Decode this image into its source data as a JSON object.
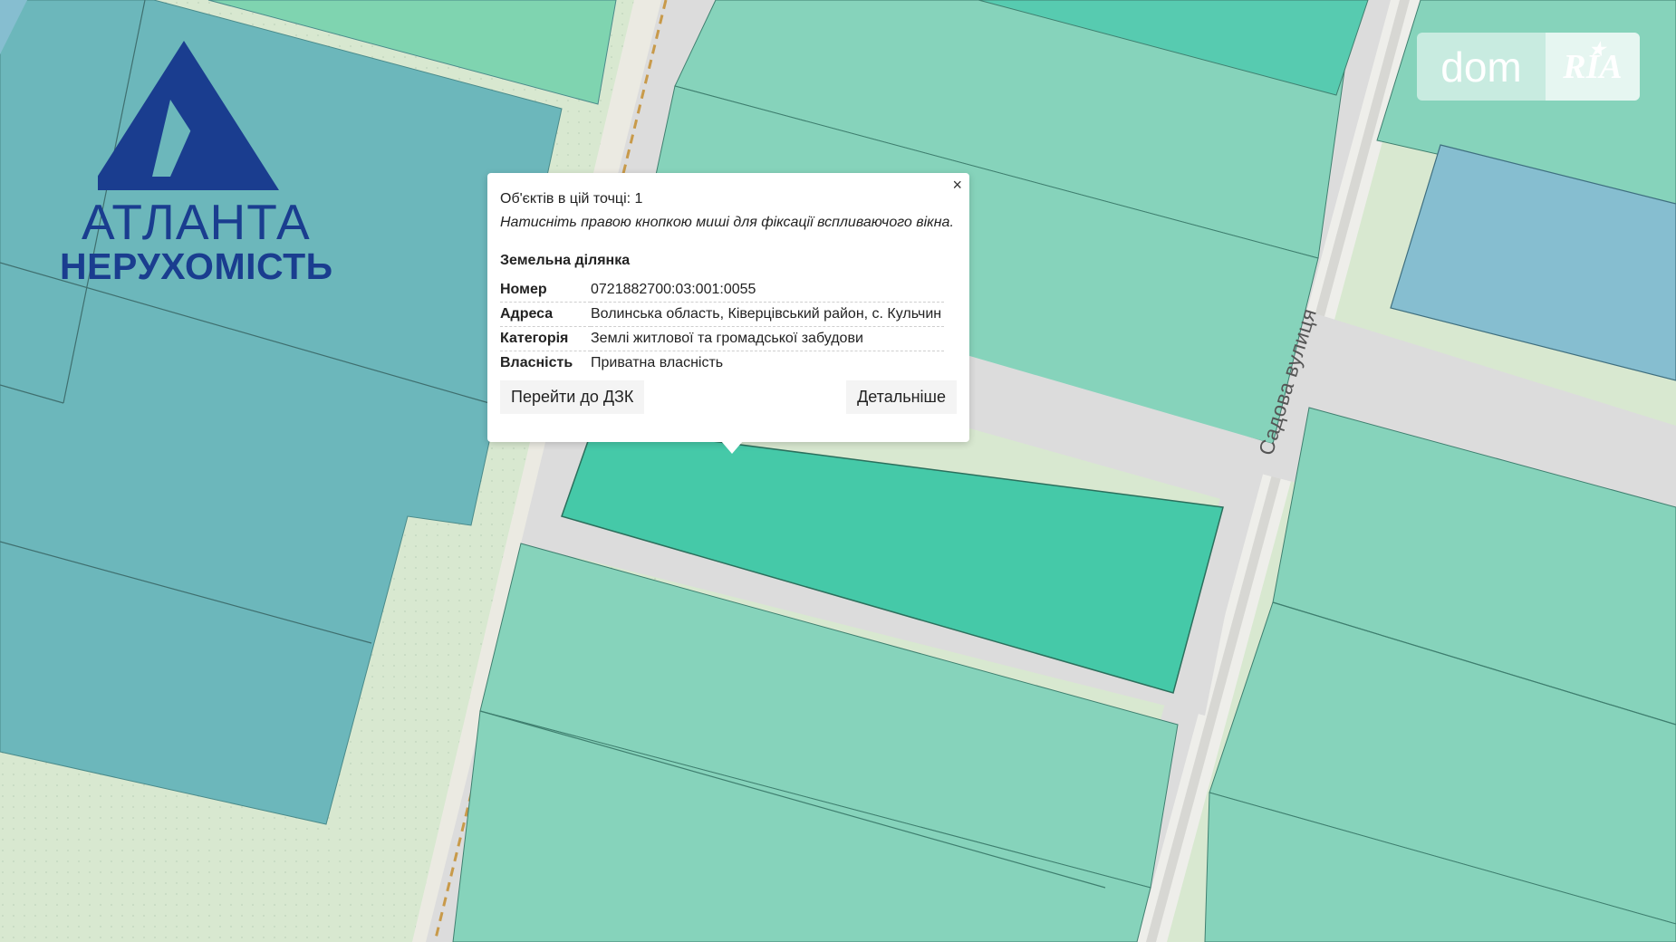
{
  "logos": {
    "atlanta_line1": "АТЛАНТА",
    "atlanta_line2": "НЕРУХОМІСТЬ",
    "dom_left": "dom",
    "dom_right": "RIA"
  },
  "map": {
    "street_label": "Садова вулиця",
    "colors": {
      "background": "#d8e8d0",
      "road": "#dcdcdc",
      "parcel": "#86d3bb",
      "parcel_selected": "#45c9a8",
      "parcel_blue": "#6cb7bb",
      "parcel_sky": "#86bed0"
    }
  },
  "popup": {
    "close_glyph": "×",
    "count_text": "Об'єктів в цій точці: 1",
    "hint_text": "Натисніть правою кнопкою миші для фіксації вспливаючого вікна.",
    "section_title": "Земельна ділянка",
    "rows": [
      {
        "key": "Номер",
        "value": "0721882700:03:001:0055"
      },
      {
        "key": "Адреса",
        "value": "Волинська область, Ківерцівський район, с. Кульчин"
      },
      {
        "key": "Категорія",
        "value": "Землі житлової та громадської забудови"
      },
      {
        "key": "Власність",
        "value": "Приватна власність"
      }
    ],
    "button_dzk": "Перейти до ДЗК",
    "button_more": "Детальніше"
  }
}
